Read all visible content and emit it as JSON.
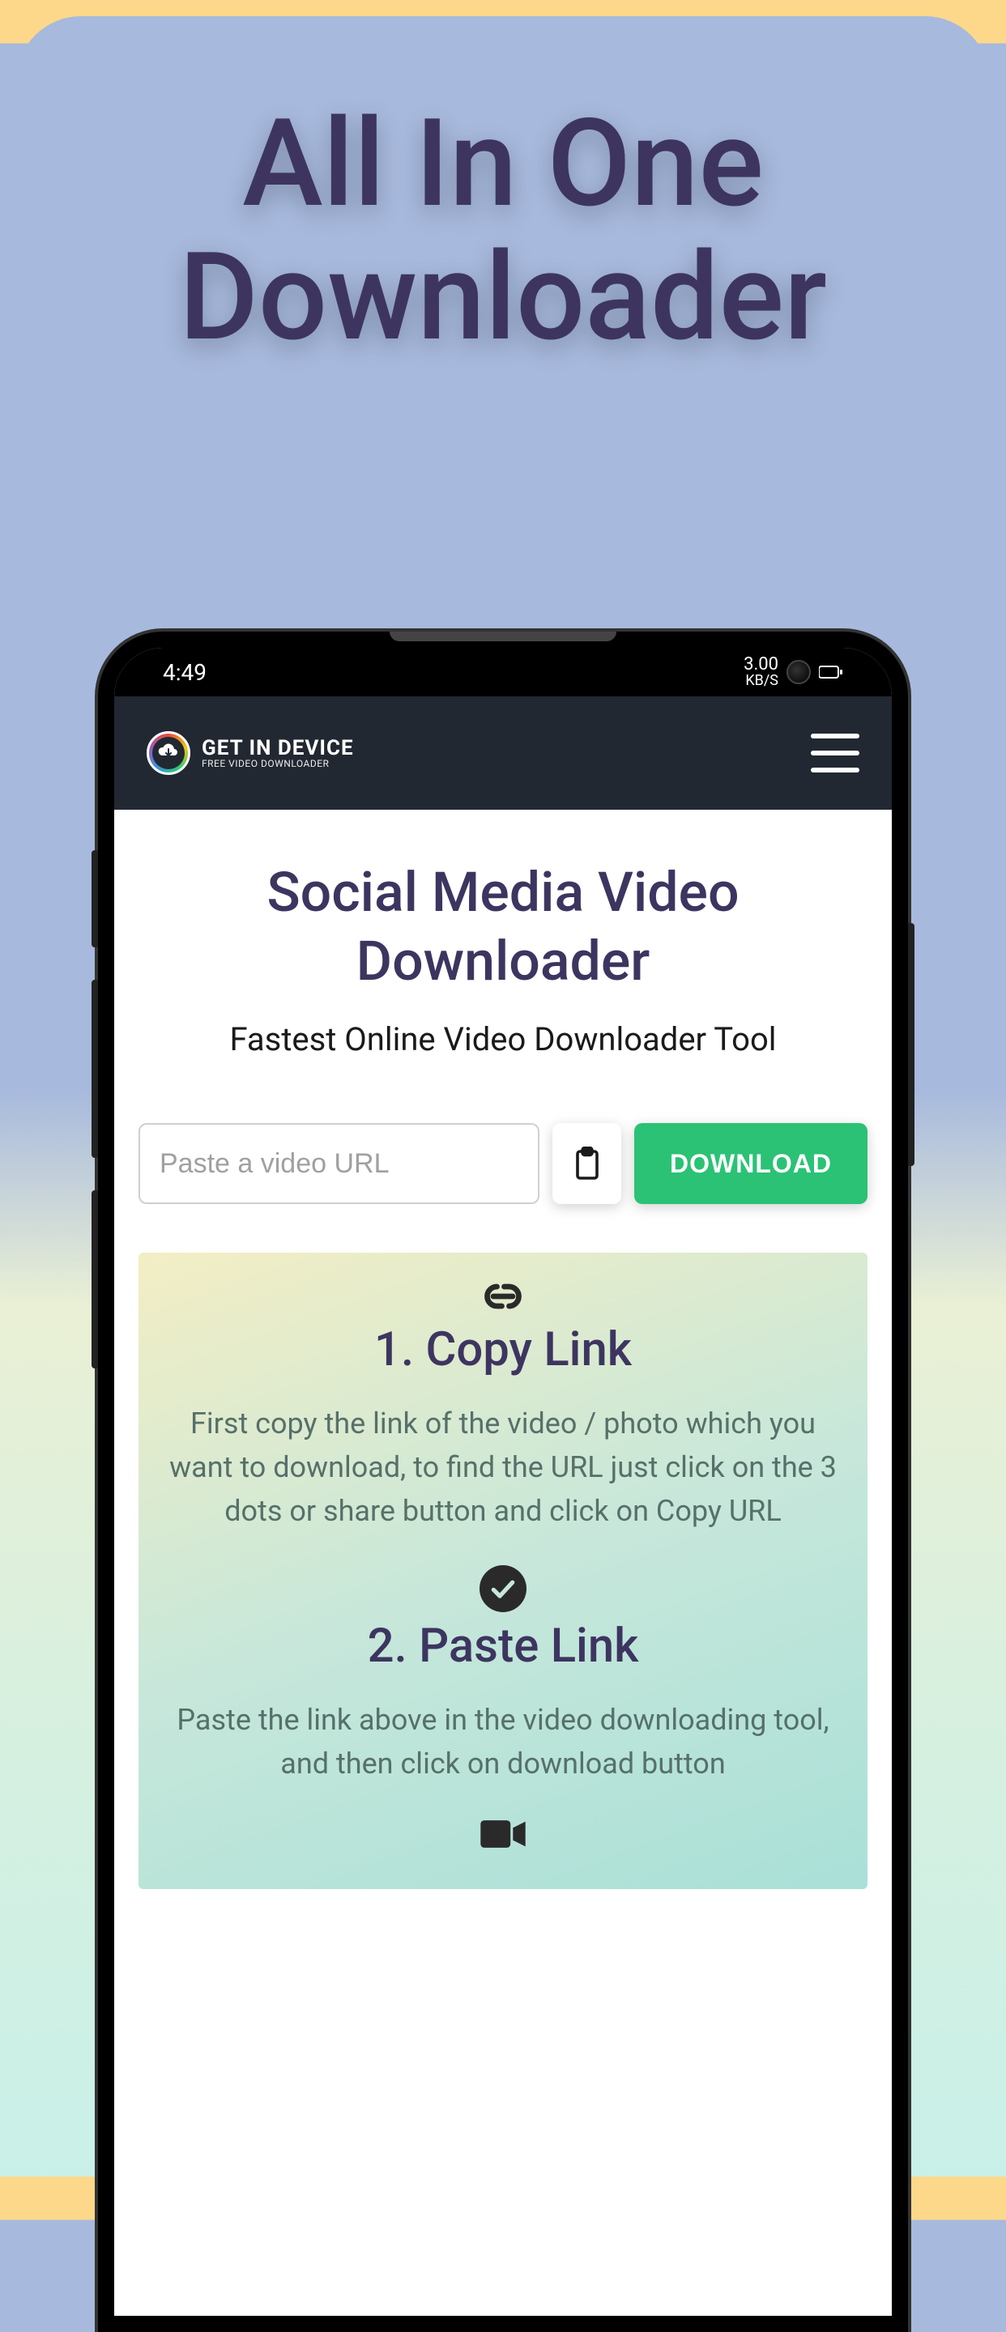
{
  "hero": {
    "title_line1": "All In One",
    "title_line2": "Downloader"
  },
  "statusbar": {
    "time": "4:49",
    "speed_value": "3.00",
    "speed_unit": "KB/S"
  },
  "app": {
    "logo_title": "GET IN DEVICE",
    "logo_sub": "FREE VIDEO DOWNLOADER"
  },
  "page": {
    "title": "Social Media Video Downloader",
    "subtitle": "Fastest Online Video Downloader Tool",
    "input_placeholder": "Paste a video URL",
    "download_label": "DOWNLOAD"
  },
  "steps": [
    {
      "icon": "link",
      "title": "1. Copy Link",
      "desc": "First copy the link of the video / photo which you want to download, to find the URL just click on the 3 dots or share button and click on Copy URL"
    },
    {
      "icon": "check",
      "title": "2. Paste Link",
      "desc": "Paste the link above in the video downloading tool, and then click on download button"
    }
  ]
}
